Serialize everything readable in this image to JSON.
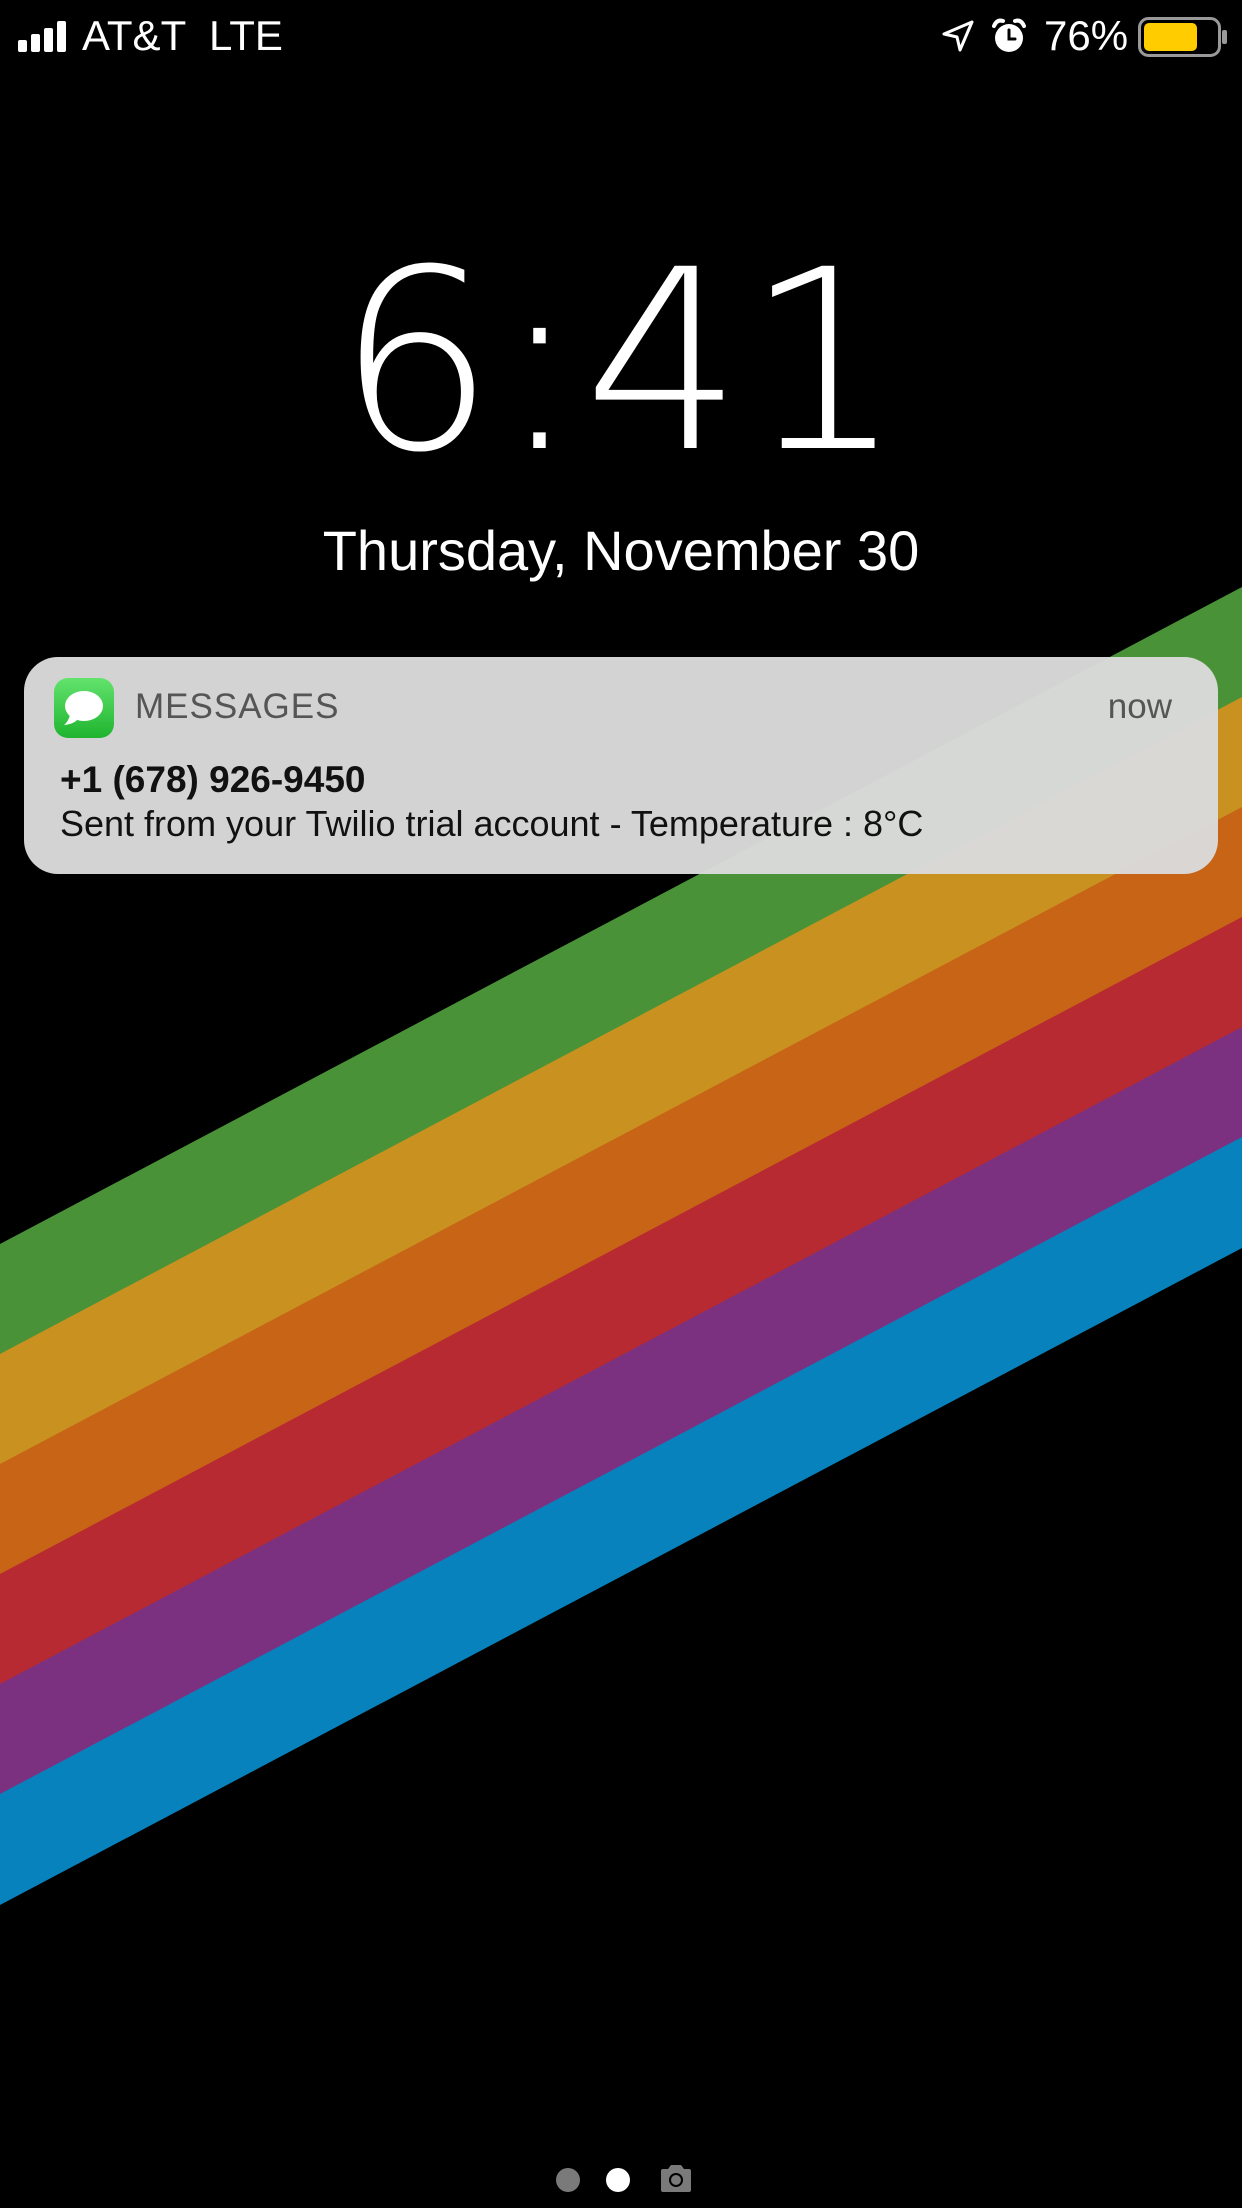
{
  "status_bar": {
    "carrier": "AT&T",
    "network": "LTE",
    "battery_percent": "76%",
    "battery_level": 0.76,
    "battery_color": "#FFCC00",
    "icons": [
      "signal-bars-icon",
      "location-arrow-icon",
      "alarm-clock-icon",
      "battery-icon"
    ]
  },
  "lock_screen": {
    "time": "6:41",
    "date": "Thursday, November 30"
  },
  "notification": {
    "app_name": "MESSAGES",
    "app_icon": "messages-app-icon",
    "time": "now",
    "sender": "+1 (678) 926-9450",
    "body": "Sent from your Twilio trial account - Temperature : 8°C"
  },
  "wallpaper": {
    "stripe_colors": [
      "#4A9237",
      "#C99220",
      "#C76416",
      "#B72A31",
      "#7B317F",
      "#0882BD"
    ]
  },
  "page_indicator": {
    "pages": 2,
    "current": 2,
    "camera_icon": "camera-icon"
  }
}
